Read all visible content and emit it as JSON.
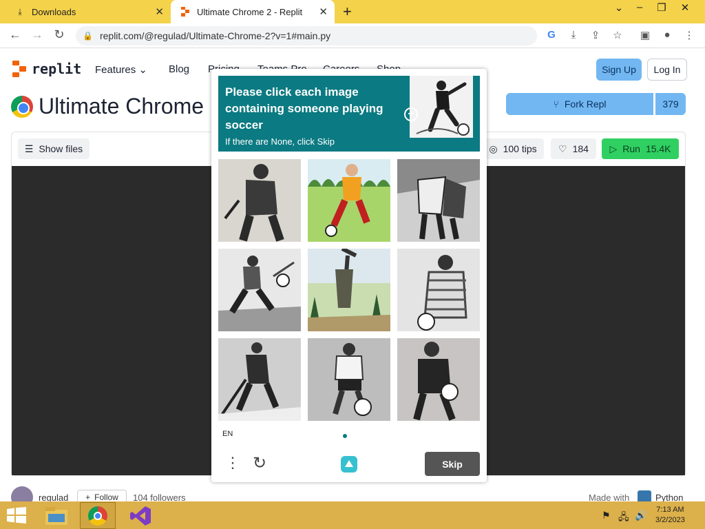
{
  "browser": {
    "tabs": [
      {
        "title": "Downloads"
      },
      {
        "title": "Ultimate Chrome 2 - Replit"
      }
    ],
    "url": "replit.com/@regulad/Ultimate-Chrome-2?v=1#main.py",
    "colors": {
      "frame": "#f4d24a"
    }
  },
  "replit": {
    "logo_text": "replit",
    "nav": [
      "Features",
      "Blog",
      "Pricing",
      "Teams Pro",
      "Careers",
      "Shop"
    ],
    "signup_label": "Sign Up",
    "login_label": "Log In",
    "title": "Ultimate Chrome",
    "fork_label": "Fork Repl",
    "fork_count": "379",
    "show_files_label": "Show files",
    "tips_label": "100 tips",
    "likes": "184",
    "run_label": "Run",
    "run_count": "15.4K",
    "footer": {
      "username": "regulad",
      "follow_label": "Follow",
      "followers": "104 followers",
      "made_with": "Made with",
      "language": "Python"
    }
  },
  "captcha": {
    "prompt": "Please click each image containing someone playing soccer",
    "subprompt": "If there are None, click Skip",
    "language": "EN",
    "skip_label": "Skip",
    "tiles": [
      "hockey player",
      "soccer player in field",
      "hockey players",
      "soccer player kicking",
      "golfer",
      "soccer player",
      "hockey player",
      "soccer player",
      "soccer player"
    ],
    "accent_color": "#0b7a82"
  },
  "taskbar": {
    "time": "7:13 AM",
    "date": "3/2/2023"
  }
}
